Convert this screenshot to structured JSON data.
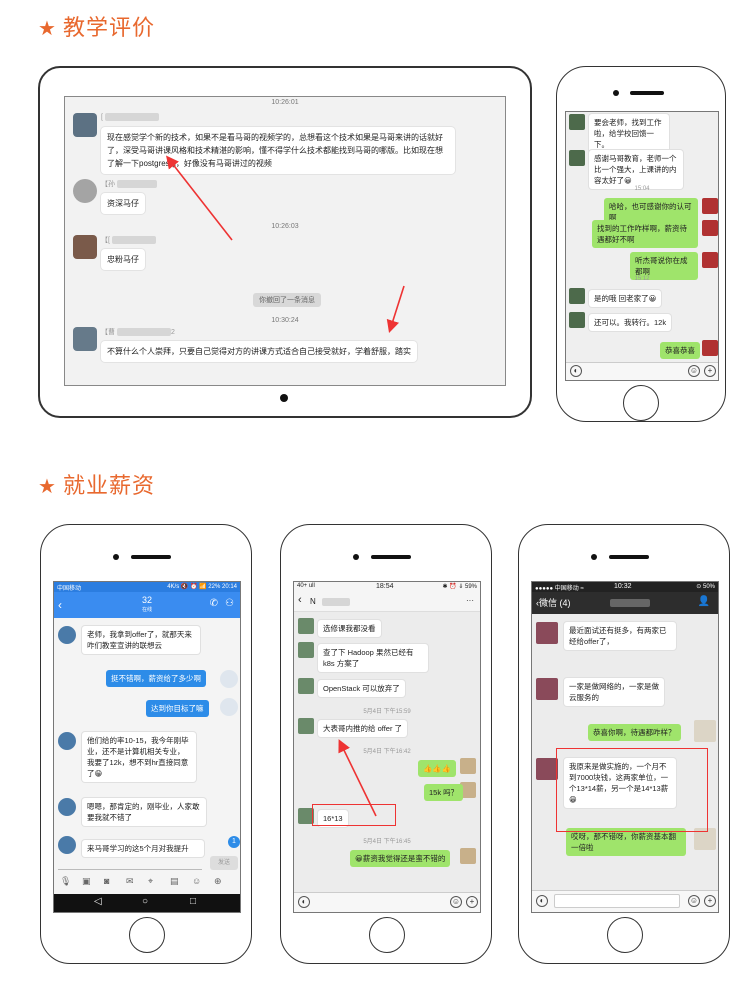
{
  "section1": {
    "title": "教学评价"
  },
  "section2": {
    "title": "就业薪资"
  },
  "tablet_chat": {
    "top_time": "10:26:01",
    "messages": [
      {
        "name": "[",
        "text": "现在感觉学个新的技术，如果不是看马哥的视频学的，总想看这个技术如果是马哥来讲的话就好了，深受马哥讲课风格和技术精湛的影响，懂不得学什么技术都能找到马哥的哪版。比如现在想了解一下postgresql，好像没有马哥讲过的视频"
      },
      {
        "name": "【孙",
        "text": "资深马仔"
      },
      {
        "name": "【[",
        "text": "忠粉马仔"
      },
      {
        "name": "【曹",
        "text": "不算什么个人崇拜，只要自己觉得对方的讲课方式适合自己接受就好，学着舒服，踏实"
      }
    ],
    "time1": "10:26:03",
    "recall": "你撤回了一条消息",
    "time2": "10:30:24",
    "name_suffix": "2"
  },
  "phone1": {
    "messages": [
      {
        "side": "L",
        "text": "要会老师，找到工作啦，给学校回馈一下。"
      },
      {
        "side": "L",
        "text": "感谢马哥教育，老师一个比一个强大，上课讲的内容太好了😀"
      },
      {
        "side": "R",
        "text": "哈哈，也可感谢你的认可啊"
      },
      {
        "side": "R",
        "text": "找到的工作咋样啊，薪资待遇都好不啊"
      },
      {
        "side": "R",
        "text": "听杰哥说你在成都啊"
      },
      {
        "side": "L",
        "text": "是的哦 回老家了😀"
      },
      {
        "side": "L",
        "text": "还可以。我转行。12k"
      },
      {
        "side": "R",
        "text": "恭喜恭喜"
      }
    ],
    "t1": "15:04",
    "t2": "15:12"
  },
  "phone2": {
    "status_left": "中国移动",
    "status_right": "4K/s 🔇 ⏰ 📶 22% 20:14",
    "title": "32",
    "subtitle": "在线",
    "messages": [
      {
        "side": "L",
        "text": "老师，我拿到offer了，就那天来咋们教室宣讲的联想云"
      },
      {
        "side": "R",
        "text": "挺不错啊，薪资给了多少啊"
      },
      {
        "side": "R",
        "text": "达到你目标了嘛"
      },
      {
        "side": "L",
        "text": "他们给的率10-15，我今年刚毕业，还不是计算机相关专业，我要了12k，想不到hr直接同意了😁"
      },
      {
        "side": "L",
        "text": "嗯嗯，那肯定的，刚毕业，人家敢要我就不错了"
      },
      {
        "side": "L",
        "text": "来马哥学习的这5个月对我提升"
      }
    ],
    "send": "发送",
    "badge": "1"
  },
  "phone3": {
    "status_left": "40+ ull",
    "status_time": "18:54",
    "status_right": "✱ ⏰ ⇓ 59%",
    "title": "N",
    "more": "···",
    "messages": [
      {
        "side": "L",
        "text": "选修课我都没看"
      },
      {
        "side": "L",
        "text": "查了下 Hadoop 果然已经有 k8s 方案了"
      },
      {
        "side": "L",
        "text": "OpenStack 可以放弃了"
      },
      {
        "side": "L",
        "text": "大表哥内推的给 offer 了"
      },
      {
        "side": "R",
        "text": "👍👍👍"
      },
      {
        "side": "R",
        "text": "15k 吗？"
      },
      {
        "side": "L",
        "text": "16*13"
      },
      {
        "side": "R",
        "text": "😀薪资我觉得还是蛮不错的"
      }
    ],
    "t1": "5月4日 下午15:59",
    "t2": "5月4日 下午16:42",
    "t3": "5月4日 下午16:45"
  },
  "phone4": {
    "status_left": "●●●●● 中国移动 ≈",
    "status_time": "10:32",
    "status_right": "⊙ 50%",
    "back": "微信 (4)",
    "messages": [
      {
        "side": "L",
        "text": "最近面试还有挺多，有两家已经给offer了，"
      },
      {
        "side": "L",
        "text": "一家是做网络的，一家是做云服务的"
      },
      {
        "side": "R",
        "text": "恭喜你啊，待遇都咋样？"
      },
      {
        "side": "L",
        "text": "我原来是做实施的，一个月不到7000块钱，这两家单位，一个13*14薪，另一个是14*13薪😁"
      },
      {
        "side": "R",
        "text": "哎呀，那不错呀，你薪资基本翻一倍啦"
      }
    ]
  }
}
